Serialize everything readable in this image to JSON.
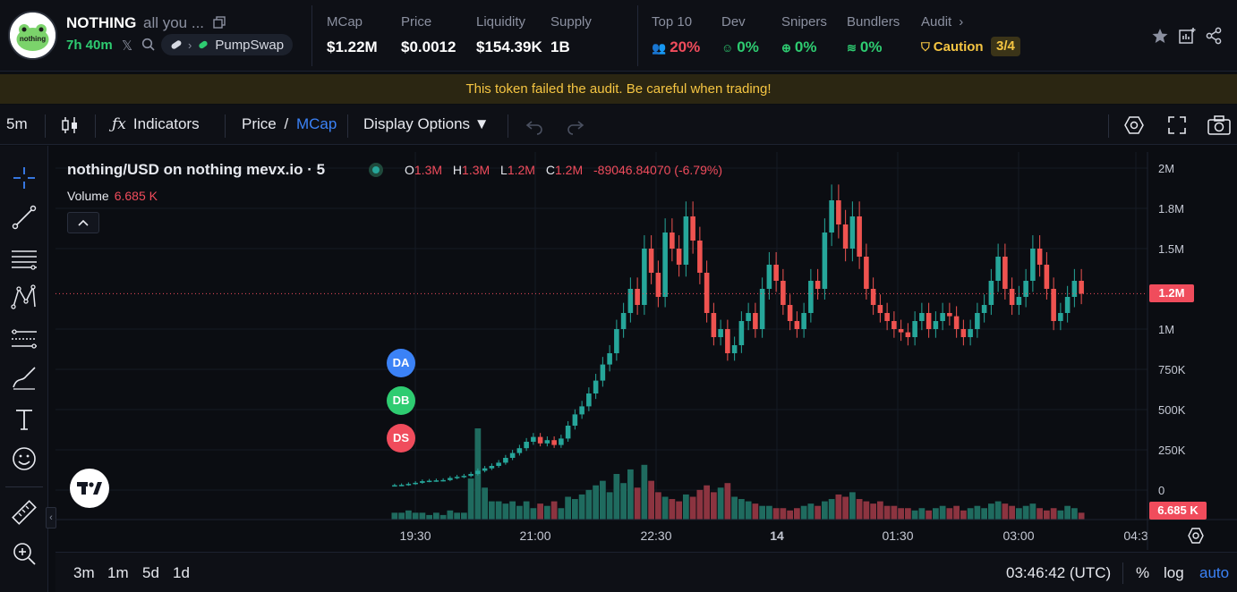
{
  "header": {
    "token_name": "NOTHING",
    "token_desc": "all you ...",
    "age": "7h 40m",
    "platform": "PumpSwap",
    "avatar_text": "nothing",
    "stats": [
      {
        "label": "MCap",
        "value": "$1.22M"
      },
      {
        "label": "Price",
        "value": "$0.0012"
      },
      {
        "label": "Liquidity",
        "value": "$154.39K"
      },
      {
        "label": "Supply",
        "value": "1B"
      }
    ],
    "audit": {
      "top10_label": "Top 10",
      "top10_value": "20%",
      "dev_label": "Dev",
      "dev_value": "0%",
      "snipers_label": "Snipers",
      "snipers_value": "0%",
      "bundlers_label": "Bundlers",
      "bundlers_value": "0%",
      "audit_label": "Audit",
      "caution_label": "Caution",
      "caution_score": "3/4"
    }
  },
  "warning": "This token failed the audit. Be careful when trading!",
  "toolbar": {
    "interval": "5m",
    "indicators": "Indicators",
    "price": "Price",
    "slash": "/",
    "mcap": "MCap",
    "display_options": "Display Options ▼"
  },
  "chart": {
    "legend_title": "nothing/USD on nothing mevx.io · 5",
    "ohlc": {
      "o_key": "O",
      "o": "1.3M",
      "h_key": "H",
      "h": "1.3M",
      "l_key": "L",
      "l": "1.2M",
      "c_key": "C",
      "c": "1.2M",
      "change": "-89046.84070 (-6.79%)"
    },
    "volume_label": "Volume",
    "volume_value": "6.685 K",
    "markers": [
      "DA",
      "DB",
      "DS"
    ],
    "price_tag": "1.2M",
    "volume_tag": "6.685 K",
    "colors": {
      "up": "#26a69a",
      "down": "#ef5350",
      "up_vol": "#1f6b5f",
      "down_vol": "#8c3440"
    }
  },
  "chart_data": {
    "type": "candlestick",
    "y_ticks": [
      "2M",
      "1.8M",
      "1.5M",
      "1.2M",
      "1M",
      "750K",
      "500K",
      "250K",
      "0"
    ],
    "x_ticks": [
      "19:30",
      "21:00",
      "22:30",
      "14",
      "01:30",
      "03:00",
      "04:3"
    ],
    "ylim": [
      0,
      2000000
    ],
    "close_series": [
      30000,
      32000,
      38000,
      45000,
      55000,
      58000,
      60000,
      62000,
      75000,
      82000,
      88000,
      100000,
      120000,
      135000,
      150000,
      170000,
      200000,
      230000,
      260000,
      300000,
      330000,
      290000,
      310000,
      280000,
      320000,
      400000,
      470000,
      520000,
      600000,
      680000,
      780000,
      850000,
      1000000,
      1100000,
      1250000,
      1150000,
      1500000,
      1350000,
      1200000,
      1600000,
      1500000,
      1400000,
      1700000,
      1550000,
      1350000,
      1100000,
      950000,
      1000000,
      850000,
      900000,
      1050000,
      1100000,
      1000000,
      1250000,
      1400000,
      1300000,
      1150000,
      1050000,
      1000000,
      1100000,
      1300000,
      1250000,
      1600000,
      1800000,
      1650000,
      1500000,
      1700000,
      1450000,
      1250000,
      1150000,
      1100000,
      1050000,
      1000000,
      980000,
      950000,
      1050000,
      1100000,
      1000000,
      1050000,
      1100000,
      1080000,
      1000000,
      950000,
      1000000,
      1100000,
      1150000,
      1300000,
      1450000,
      1250000,
      1150000,
      1200000,
      1300000,
      1500000,
      1400000,
      1250000,
      1050000,
      1100000,
      1200000,
      1300000,
      1220000
    ],
    "volume_bars": [
      3,
      3,
      4,
      3,
      3,
      2,
      3,
      2,
      4,
      3,
      3,
      18,
      40,
      14,
      8,
      8,
      7,
      8,
      6,
      8,
      5,
      7,
      6,
      8,
      5,
      10,
      9,
      11,
      13,
      15,
      17,
      12,
      20,
      16,
      22,
      14,
      24,
      17,
      12,
      10,
      9,
      8,
      11,
      10,
      13,
      15,
      12,
      14,
      16,
      10,
      9,
      8,
      7,
      6,
      6,
      5,
      5,
      4,
      5,
      6,
      7,
      6,
      8,
      9,
      11,
      10,
      12,
      9,
      8,
      7,
      8,
      6,
      6,
      5,
      5,
      4,
      5,
      4,
      5,
      6,
      5,
      6,
      4,
      5,
      6,
      5,
      7,
      8,
      7,
      6,
      5,
      6,
      7,
      5,
      4,
      5,
      4,
      6,
      5,
      3
    ]
  },
  "bottom_bar": {
    "ranges": [
      "3m",
      "1m",
      "5d",
      "1d"
    ],
    "clock": "03:46:42 (UTC)",
    "percent": "%",
    "log": "log",
    "auto": "auto"
  }
}
